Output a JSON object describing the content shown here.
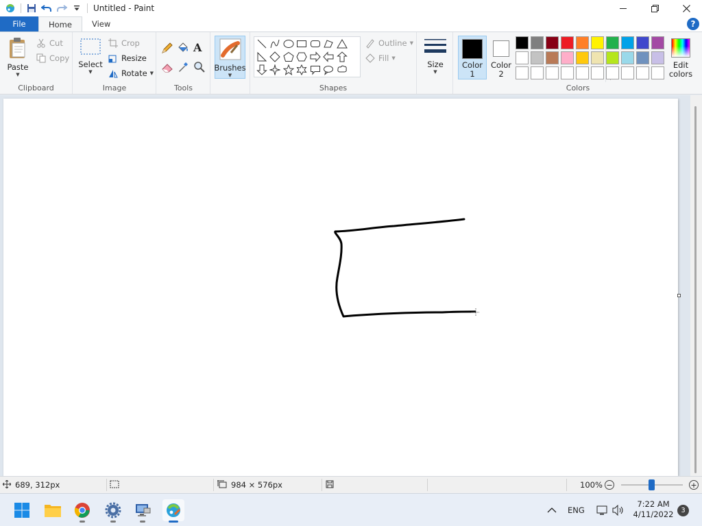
{
  "window": {
    "title": "Untitled - Paint"
  },
  "tabs": {
    "file": "File",
    "home": "Home",
    "view": "View",
    "help": "?"
  },
  "ribbon": {
    "clipboard": {
      "label": "Clipboard",
      "paste": "Paste",
      "cut": "Cut",
      "copy": "Copy"
    },
    "image": {
      "label": "Image",
      "select": "Select",
      "crop": "Crop",
      "resize": "Resize",
      "rotate": "Rotate"
    },
    "tools": {
      "label": "Tools",
      "text_glyph": "A"
    },
    "brushes": {
      "label": "Brushes"
    },
    "shapes": {
      "label": "Shapes",
      "outline": "Outline",
      "fill": "Fill"
    },
    "size": {
      "label": "Size"
    },
    "colors": {
      "label": "Colors",
      "color1_line1": "Color",
      "color1_line2": "1",
      "color2_line1": "Color",
      "color2_line2": "2",
      "edit_line1": "Edit",
      "edit_line2": "colors",
      "color1_value": "#000000",
      "color2_value": "#ffffff",
      "palette_row1": [
        "#000000",
        "#7f7f7f",
        "#880015",
        "#ed1c24",
        "#ff7f27",
        "#fff200",
        "#22b14c",
        "#00a2e8",
        "#3f48cc",
        "#a349a4"
      ],
      "palette_row2": [
        "#ffffff",
        "#c3c3c3",
        "#b97a57",
        "#ffaec9",
        "#ffc90e",
        "#efe4b0",
        "#b5e61d",
        "#99d9ea",
        "#7092be",
        "#c8bfe7"
      ],
      "palette_row3": [
        "#ffffff",
        "#ffffff",
        "#ffffff",
        "#ffffff",
        "#ffffff",
        "#ffffff",
        "#ffffff",
        "#ffffff",
        "#ffffff",
        "#ffffff"
      ]
    }
  },
  "status": {
    "cursor_pos": "689, 312px",
    "canvas_size": "984 × 576px",
    "zoom": "100%"
  },
  "taskbar": {
    "lang": "ENG",
    "time": "7:22 AM",
    "date": "4/11/2022",
    "notifications": "3"
  }
}
